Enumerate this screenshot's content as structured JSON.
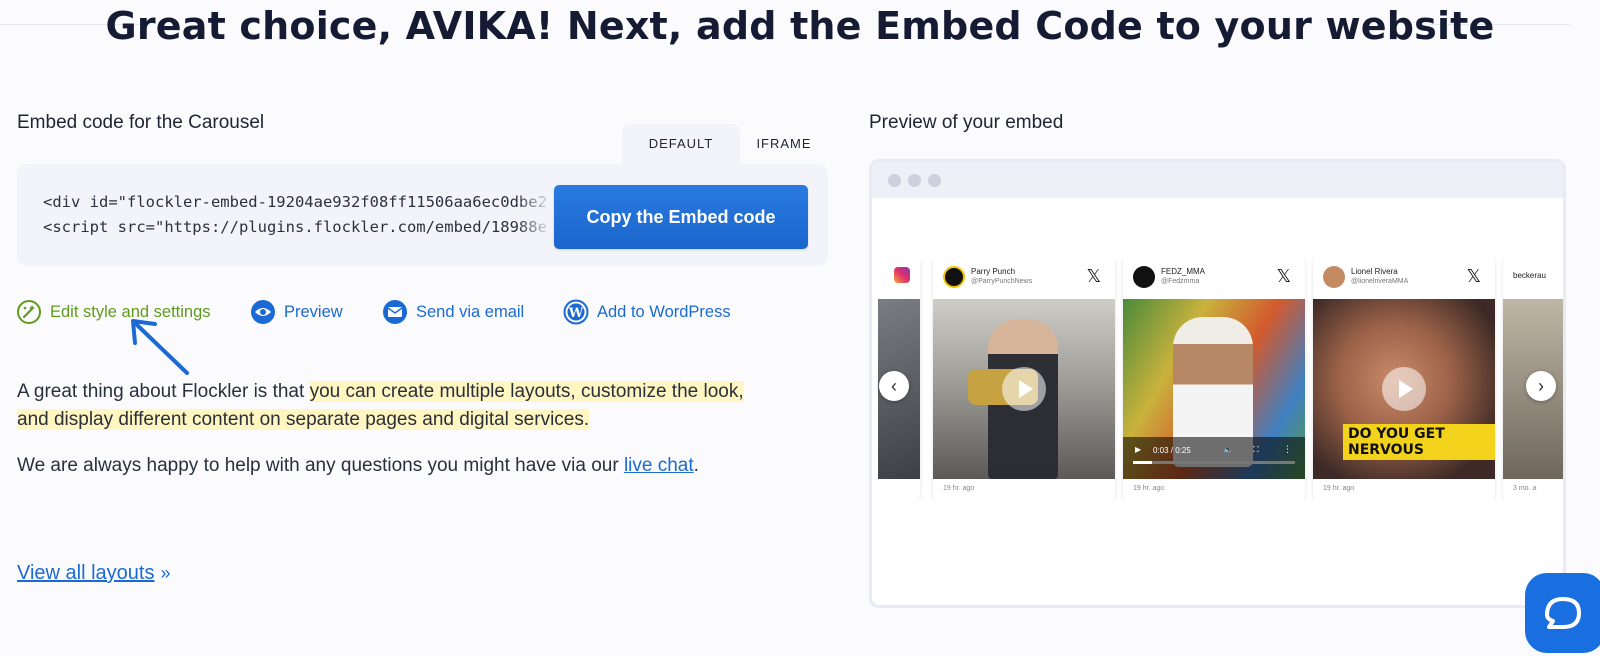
{
  "header": {
    "title": "Great choice, AVIKA! Next, add the Embed Code to your website"
  },
  "embed": {
    "section_label": "Embed code for the Carousel",
    "tabs": [
      {
        "label": "DEFAULT",
        "active": true
      },
      {
        "label": "IFRAME",
        "active": false
      }
    ],
    "code_lines": [
      "<div id=\"flockler-embed-19204ae932f08ff11506aa6ec0dbe2",
      "<script src=\"https://plugins.flockler.com/embed/18988e"
    ],
    "copy_button": "Copy the Embed code"
  },
  "actions": [
    {
      "label": "Edit style and settings",
      "icon": "settings-sparkle-icon"
    },
    {
      "label": "Preview",
      "icon": "eye-icon"
    },
    {
      "label": "Send via email",
      "icon": "envelope-icon"
    },
    {
      "label": "Add to WordPress",
      "icon": "wordpress-icon"
    }
  ],
  "info": {
    "p1_before": "A great thing about Flockler is that ",
    "p1_highlight_1": "you can create multiple layouts, customize the look,",
    "p1_highlight_2": "and display different content on separate pages and digital services.",
    "p2_before": "We are always happy to help with any questions you might have via our ",
    "p2_link": "live chat",
    "p2_after": ".",
    "view_all": "View all layouts",
    "view_all_suffix": "»"
  },
  "preview": {
    "section_label": "Preview of your embed",
    "cards": [
      {
        "name": "Parry Punch",
        "handle": "@ParryPunchNews",
        "time": "19 hr. ago"
      },
      {
        "name": "FEDZ_MMA",
        "handle": "@Fedzmma",
        "time": "19 hr. ago",
        "video_time": "0:03 / 0:25"
      },
      {
        "name": "Lionel Rivera",
        "handle": "@lionelriveraMMA",
        "time": "19 hr. ago",
        "caption": "DO YOU GET NERVOUS"
      },
      {
        "name": "beckerau",
        "time": "3 mo. a"
      }
    ]
  },
  "colors": {
    "accent": "#1b6ad3",
    "green": "#5e9b1a",
    "highlight": "#fff6c2",
    "chat": "#1a6fe0"
  }
}
